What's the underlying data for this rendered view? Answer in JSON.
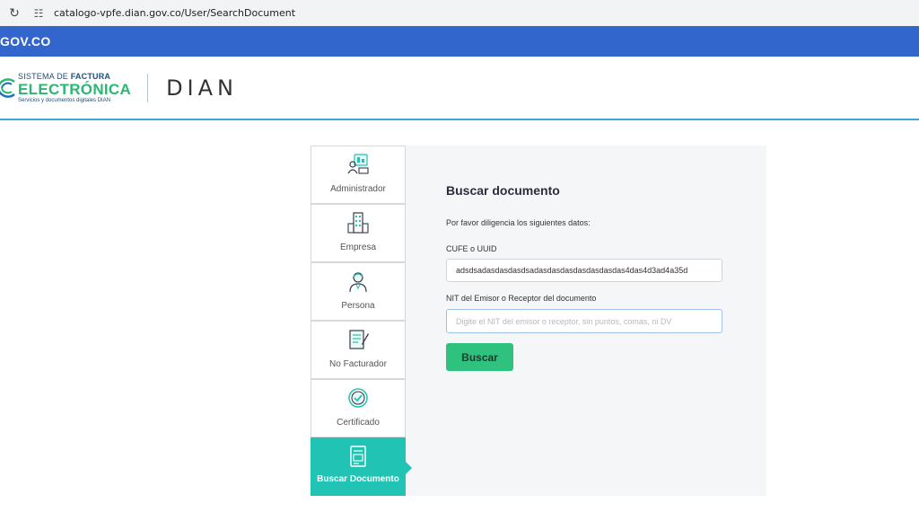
{
  "browser": {
    "reload_icon": "reload-icon",
    "site_icon": "site-info-icon",
    "url": "catalogo-vpfe.dian.gov.co/User/SearchDocument"
  },
  "gov_bar": {
    "logo": "GOV.CO"
  },
  "header": {
    "brand_line1_prefix": "SISTEMA DE ",
    "brand_line1_bold": "FACTURA",
    "brand_line2": "ELECTRÓNICA",
    "brand_line3": "Servicios y documentos digitales DIAN",
    "dian": "DIAN"
  },
  "menu": {
    "items": [
      {
        "label": "Administrador",
        "icon": "administrator-icon"
      },
      {
        "label": "Empresa",
        "icon": "building-icon"
      },
      {
        "label": "Persona",
        "icon": "person-icon"
      },
      {
        "label": "No Facturador",
        "icon": "document-edit-icon"
      },
      {
        "label": "Certificado",
        "icon": "certificate-icon"
      },
      {
        "label": "Buscar Documento",
        "icon": "search-document-icon"
      }
    ]
  },
  "form": {
    "title": "Buscar documento",
    "subtitle": "Por favor diligencia los siguientes datos:",
    "cufe_label": "CUFE o UUID",
    "cufe_value": "adsdsadasdasdasdsadasdasdasdasdasdasdas4das4d3ad4a35d",
    "nit_label": "NIT del Emisor o Receptor del documento",
    "nit_placeholder": "Digite el NIT del emisor o receptor, sin puntos, comas, ni DV",
    "button": "Buscar"
  },
  "colors": {
    "gov_blue": "#3366cc",
    "accent_teal": "#21c3b4",
    "button_green": "#2ec27e",
    "header_line": "#3ea8dd"
  }
}
